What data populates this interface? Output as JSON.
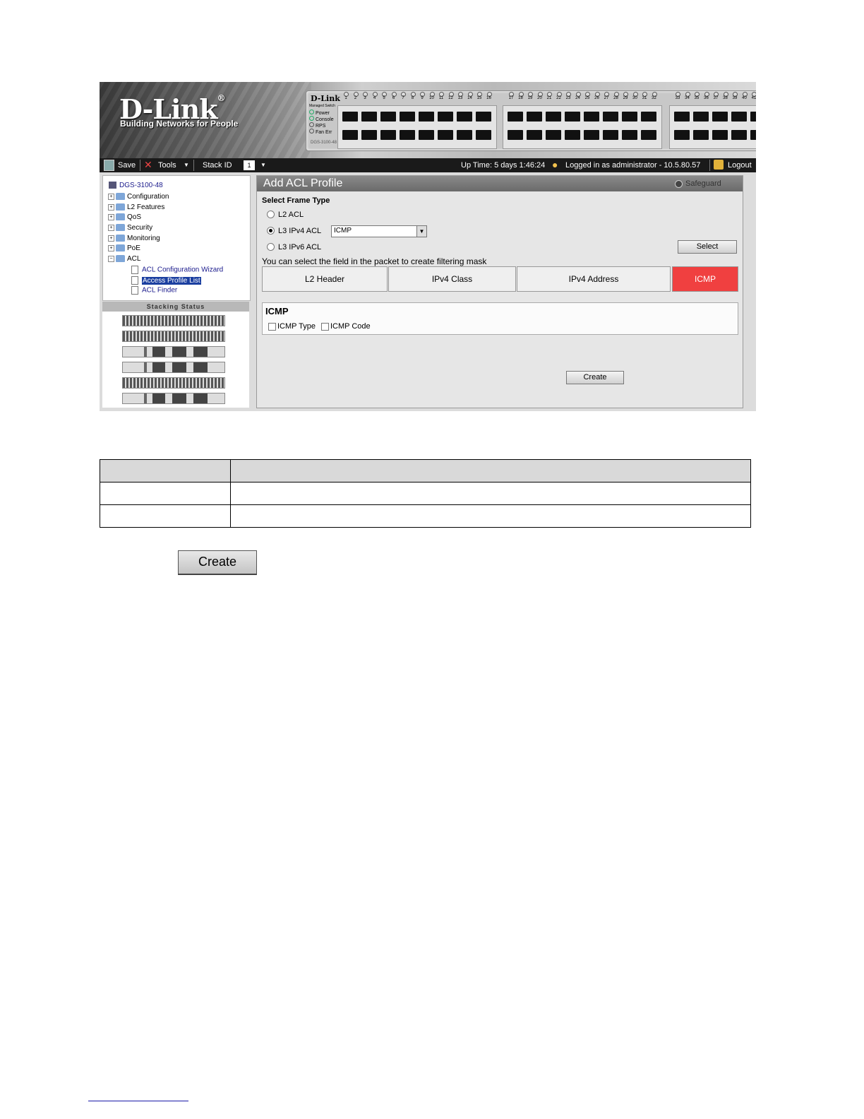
{
  "brand": {
    "logo": "D-Link",
    "logo_mark": "®",
    "tagline": "Building Networks for People"
  },
  "device": {
    "brand": "D-Link",
    "subtitle": "Managed Switch",
    "leds": [
      "Power",
      "Console",
      "RPS",
      "Fan Err"
    ],
    "model": "DGS-3100-48",
    "port_numbers_group1": [
      "1",
      "2",
      "3",
      "4",
      "5",
      "6",
      "7",
      "8",
      "9",
      "10",
      "11",
      "12",
      "13",
      "14",
      "15",
      "16"
    ],
    "port_numbers_group2": [
      "17",
      "18",
      "19",
      "20",
      "21",
      "22",
      "23",
      "24",
      "25",
      "26",
      "27",
      "28",
      "29",
      "30",
      "31",
      "32"
    ],
    "port_numbers_group3": [
      "33",
      "34",
      "35",
      "36",
      "37",
      "38",
      "39",
      "40",
      "41"
    ]
  },
  "toolbar": {
    "save": "Save",
    "tools": "Tools",
    "stack_id": "Stack ID",
    "stack_value": "1",
    "uptime": "Up Time: 5 days 1:46:24",
    "logged_in": "Logged in as administrator - 10.5.80.57",
    "logout": "Logout"
  },
  "tree": {
    "root": "DGS-3100-48",
    "items": [
      "Configuration",
      "L2 Features",
      "QoS",
      "Security",
      "Monitoring",
      "PoE",
      "ACL"
    ],
    "acl_children": [
      "ACL Configuration Wizard",
      "Access Profile List",
      "ACL Finder"
    ],
    "selected": "Access Profile List"
  },
  "stacking": {
    "title": "Stacking Status"
  },
  "main": {
    "title": "Add ACL Profile",
    "safeguard": "Safeguard",
    "select_frame_type": "Select Frame Type",
    "radio_l2": "L2 ACL",
    "radio_ipv4": "L3 IPv4 ACL",
    "radio_ipv6": "L3 IPv6 ACL",
    "ipv4_select_value": "ICMP",
    "select_button": "Select",
    "hint": "You can select the field in the packet to create filtering mask",
    "tabs": [
      "L2 Header",
      "IPv4 Class",
      "IPv4 Address",
      "ICMP"
    ],
    "active_tab": "ICMP",
    "icmp_section_title": "ICMP",
    "icmp_type": "ICMP Type",
    "icmp_code": "ICMP Code",
    "create_button": "Create"
  },
  "page": {
    "create_button": "Create"
  },
  "colors": {
    "active_tab": "#f04040",
    "selected_tree": "#1b3fa0",
    "link": "#1a1a8c"
  }
}
